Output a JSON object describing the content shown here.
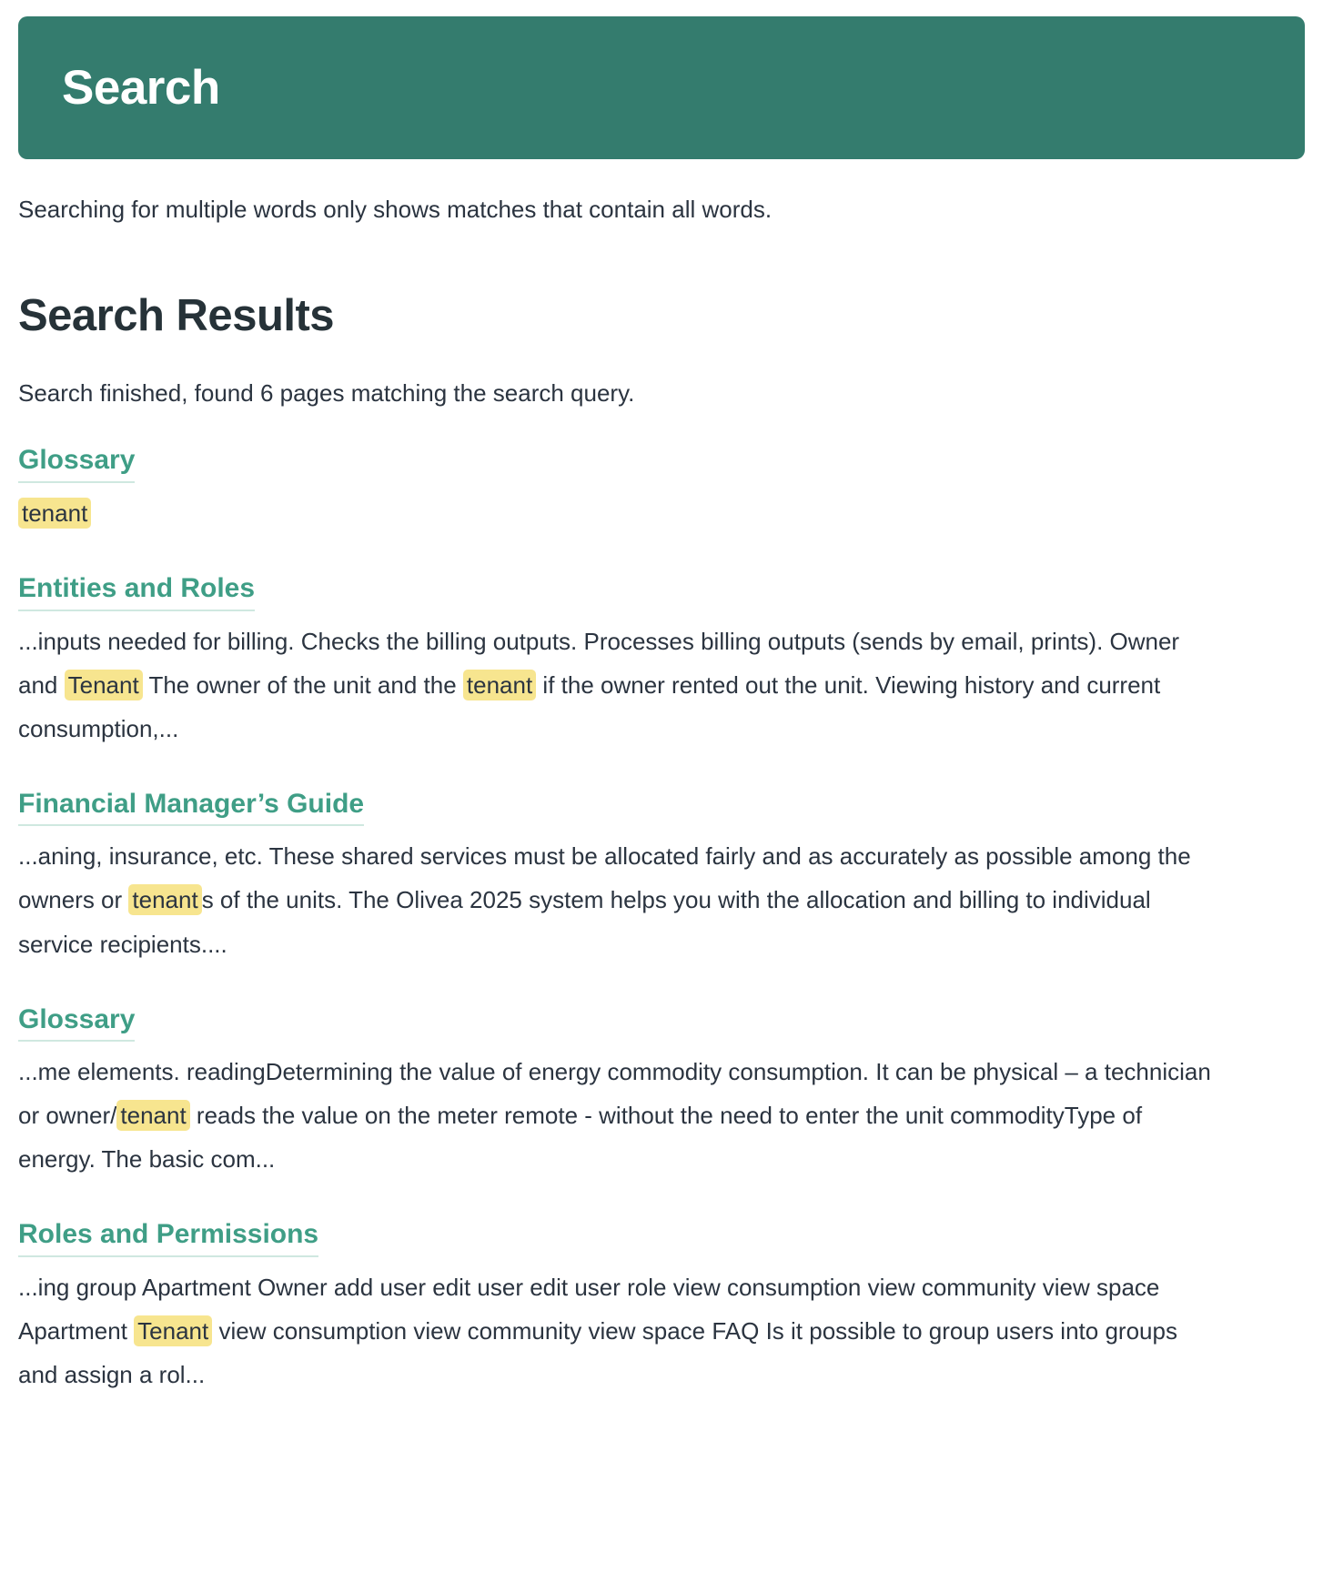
{
  "header": {
    "title": "Search",
    "bg_color": "#347c6e",
    "text_color": "#ffffff"
  },
  "intro": {
    "note": "Searching for multiple words only shows matches that contain all words."
  },
  "results_section": {
    "heading": "Search Results",
    "status": "Search finished, found 6 pages matching the search query.",
    "found_count": 6
  },
  "colors": {
    "link": "#3f9e86",
    "highlight": "#f7e58f",
    "body_text": "#2b3440",
    "heading": "#263238",
    "link_underline": "#cfe8e0"
  },
  "results": [
    {
      "title": "Glossary",
      "excerpt_parts": [
        {
          "text": "tenant",
          "highlight": true
        }
      ]
    },
    {
      "title": "Entities and Roles",
      "excerpt_parts": [
        {
          "text": "...inputs needed for billing. Checks the billing outputs. Processes billing outputs (sends by email, prints). Owner and ",
          "highlight": false
        },
        {
          "text": "Tenant",
          "highlight": true
        },
        {
          "text": " The owner of the unit and the ",
          "highlight": false
        },
        {
          "text": "tenant",
          "highlight": true
        },
        {
          "text": " if the owner rented out the unit. Viewing history and current consumption,...",
          "highlight": false
        }
      ]
    },
    {
      "title": "Financial Manager’s Guide",
      "excerpt_parts": [
        {
          "text": "...aning, insurance, etc. These shared services must be allocated fairly and as accurately as possible among the owners or ",
          "highlight": false
        },
        {
          "text": "tenant",
          "highlight": true
        },
        {
          "text": "s of the units. The Olivea 2025 system helps you with the allocation and billing to individual service recipients....",
          "highlight": false
        }
      ]
    },
    {
      "title": "Glossary",
      "excerpt_parts": [
        {
          "text": "...me elements. readingDetermining the value of energy commodity consumption. It can be physical – a technician or owner/",
          "highlight": false
        },
        {
          "text": "tenant",
          "highlight": true
        },
        {
          "text": " reads the value on the meter remote - without the need to enter the unit commodityType of energy. The basic com...",
          "highlight": false
        }
      ]
    },
    {
      "title": "Roles and Permissions",
      "excerpt_parts": [
        {
          "text": "...ing group Apartment Owner add user edit user edit user role view consumption view community view space Apartment ",
          "highlight": false
        },
        {
          "text": "Tenant",
          "highlight": true
        },
        {
          "text": " view consumption view community view space FAQ Is it possible to group users into groups and assign a rol...",
          "highlight": false
        }
      ]
    }
  ]
}
